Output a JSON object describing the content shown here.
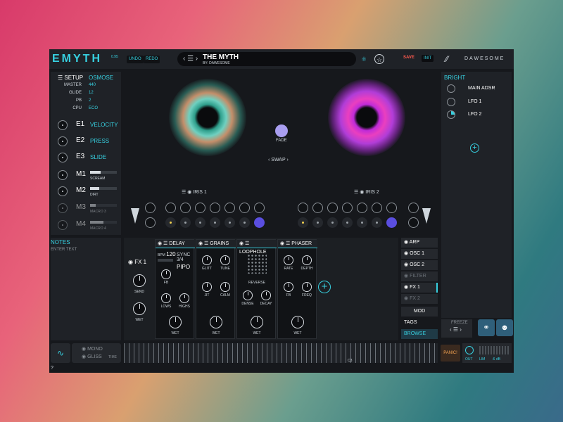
{
  "app": {
    "logo": "EMYTH",
    "version": "0.95",
    "undo": "UNDO",
    "redo": "REDO",
    "preset_name": "THE MYTH",
    "preset_by": "BY: DAWESOME",
    "save": "SAVE",
    "init": "INIT",
    "brand": "DAWESOME",
    "accent": "#37d0e0"
  },
  "setup": {
    "title": "SETUP",
    "engine": "OSMOSE",
    "rows": [
      {
        "k": "MASTER",
        "v": "440"
      },
      {
        "k": "GLIDE",
        "v": "12"
      },
      {
        "k": "PB",
        "v": "2"
      },
      {
        "k": "CPU",
        "v": "ECO"
      }
    ],
    "expressions": [
      {
        "label": "E1",
        "value": "VELOCITY"
      },
      {
        "label": "E2",
        "value": "PRESS"
      },
      {
        "label": "E3",
        "value": "SLIDE"
      }
    ],
    "macros": [
      {
        "label": "M1",
        "name": "SCREAM",
        "level": 0.4
      },
      {
        "label": "M2",
        "name": "DIRT",
        "level": 0.35
      },
      {
        "label": "M3",
        "name": "MACRO 3",
        "level": 0.2
      },
      {
        "label": "M4",
        "name": "MACRO 4",
        "level": 0.5
      }
    ]
  },
  "center": {
    "fade": "FADE",
    "swap": "SWAP",
    "iris1": "IRIS 1",
    "iris2": "IRIS 2"
  },
  "bright": {
    "title": "BRIGHT",
    "items": [
      "MAIN ADSR",
      "LFO 1",
      "LFO 2"
    ]
  },
  "notes": {
    "title": "NOTES",
    "placeholder": "ENTER TEXT"
  },
  "fx": {
    "fx1": "FX 1",
    "send": "SEND",
    "wet": "WET",
    "delay": {
      "title": "DELAY",
      "bpm_label": "BPM",
      "bpm": "120",
      "sync": "SYNC",
      "division": "3/4",
      "mode": "PIPO",
      "fb": "FB",
      "lows": "LOWS",
      "highs": "HIGHS",
      "wet": "WET"
    },
    "grains": {
      "title": "GRAINS",
      "glitt": "GLITT",
      "tune": "TUNE",
      "jit": "JIT",
      "calm": "CALM",
      "wet": "WET"
    },
    "loophole": {
      "title": "LOOPHOLE",
      "reverse": "REVERSE",
      "dense": "DENSE",
      "decay": "DECAY",
      "wet": "WET"
    },
    "phaser": {
      "title": "PHASER",
      "rate": "RATE",
      "depth": "DEPTH",
      "fb": "FB",
      "freq": "FREQ",
      "wet": "WET"
    }
  },
  "modlist": {
    "items": [
      {
        "label": "ARP",
        "on": true
      },
      {
        "label": "OSC 1",
        "on": true
      },
      {
        "label": "OSC 2",
        "on": true
      },
      {
        "label": "FILTER",
        "on": false
      },
      {
        "label": "FX 1",
        "on": true
      },
      {
        "label": "FX 2",
        "on": false
      }
    ],
    "mod": "MOD",
    "tags": "TAGS",
    "browse": "BROWSE"
  },
  "bottom": {
    "mono": "MONO",
    "gliss": "GLISS",
    "time": "TIME",
    "c3": "C3",
    "freeze": "FREEZE",
    "panic": "PANIC!",
    "out": "OUT",
    "lim": "LIM",
    "db": "-6 dB",
    "help": "?"
  }
}
